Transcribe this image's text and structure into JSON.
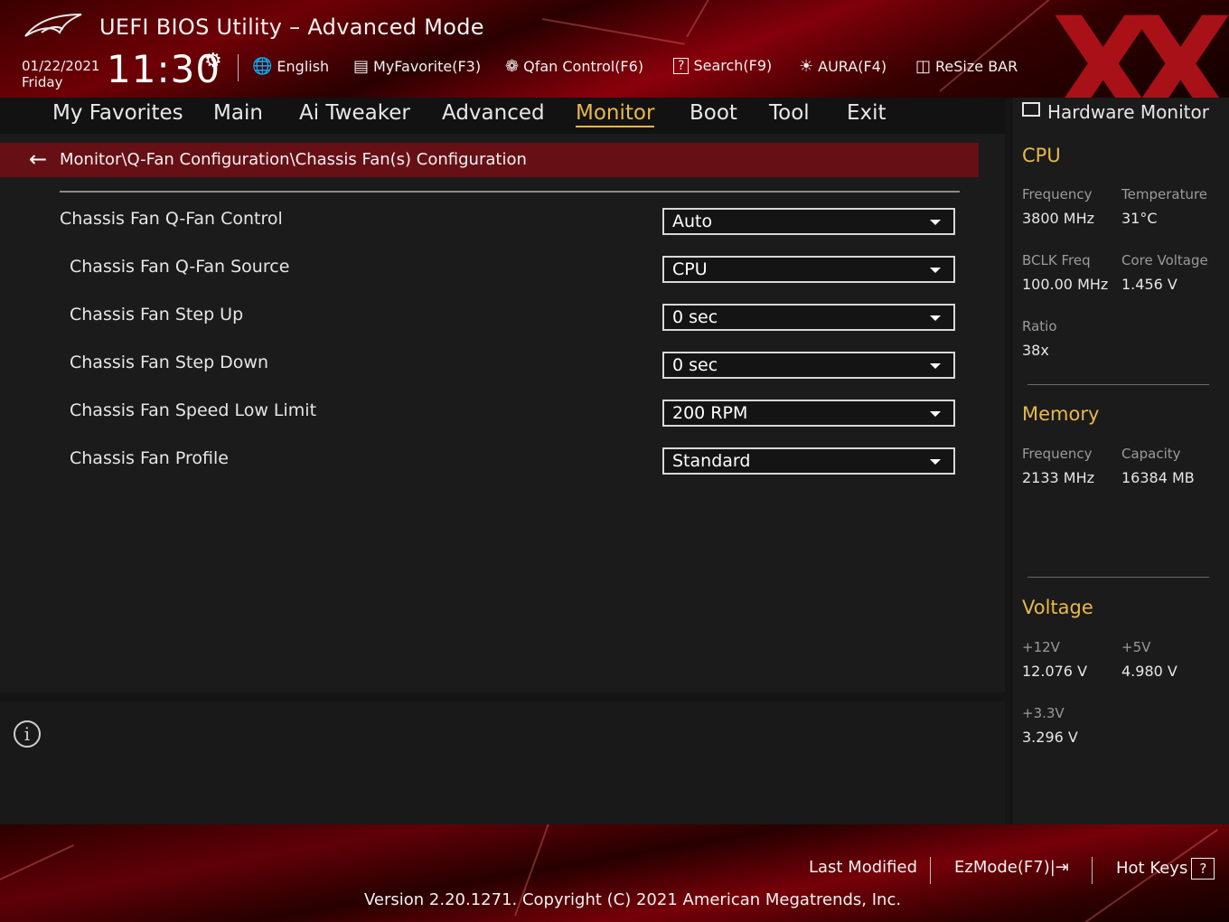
{
  "header": {
    "title": "UEFI BIOS Utility – Advanced Mode",
    "date": "01/22/2021",
    "day": "Friday",
    "time": "11:30",
    "toolbar": [
      {
        "label": "English",
        "icon": "globe-icon"
      },
      {
        "label": "MyFavorite(F3)",
        "icon": "favorites-list-icon"
      },
      {
        "label": "Qfan Control(F6)",
        "icon": "fan-icon"
      },
      {
        "label": "Search(F9)",
        "icon": "search-help-icon"
      },
      {
        "label": "AURA(F4)",
        "icon": "aura-light-icon"
      },
      {
        "label": "ReSize BAR",
        "icon": "resize-bar-icon"
      }
    ]
  },
  "nav": {
    "tabs": [
      "My Favorites",
      "Main",
      "Ai Tweaker",
      "Advanced",
      "Monitor",
      "Boot",
      "Tool",
      "Exit"
    ],
    "active": "Monitor"
  },
  "breadcrumb": "Monitor\\Q-Fan Configuration\\Chassis Fan(s) Configuration",
  "settings": [
    {
      "label": "Chassis Fan Q-Fan Control",
      "value": "Auto"
    },
    {
      "label": "Chassis Fan Q-Fan Source",
      "value": "CPU"
    },
    {
      "label": "Chassis Fan Step Up",
      "value": "0 sec"
    },
    {
      "label": "Chassis Fan Step Down",
      "value": "0 sec"
    },
    {
      "label": "Chassis Fan Speed Low Limit",
      "value": "200 RPM"
    },
    {
      "label": "Chassis Fan Profile",
      "value": "Standard"
    }
  ],
  "hw_monitor": {
    "title": "Hardware Monitor",
    "cpu": {
      "heading": "CPU",
      "frequency_label": "Frequency",
      "frequency": "3800 MHz",
      "temperature_label": "Temperature",
      "temperature": "31°C",
      "bclk_label": "BCLK Freq",
      "bclk": "100.00 MHz",
      "core_voltage_label": "Core Voltage",
      "core_voltage": "1.456 V",
      "ratio_label": "Ratio",
      "ratio": "38x"
    },
    "memory": {
      "heading": "Memory",
      "frequency_label": "Frequency",
      "frequency": "2133 MHz",
      "capacity_label": "Capacity",
      "capacity": "16384 MB"
    },
    "voltage": {
      "heading": "Voltage",
      "v12_label": "+12V",
      "v12": "12.076 V",
      "v5_label": "+5V",
      "v5": "4.980 V",
      "v33_label": "+3.3V",
      "v33": "3.296 V"
    }
  },
  "footer": {
    "last_modified": "Last Modified",
    "ezmode": "EzMode(F7)|",
    "hot_keys": "Hot Keys",
    "hot_keys_key": "?",
    "version": "Version 2.20.1271. Copyright (C) 2021 American Megatrends, Inc."
  },
  "colors": {
    "accent": "#e8b84a",
    "breadcrumb_bg": "#661016",
    "panel_bg": "#1b1b1b"
  }
}
